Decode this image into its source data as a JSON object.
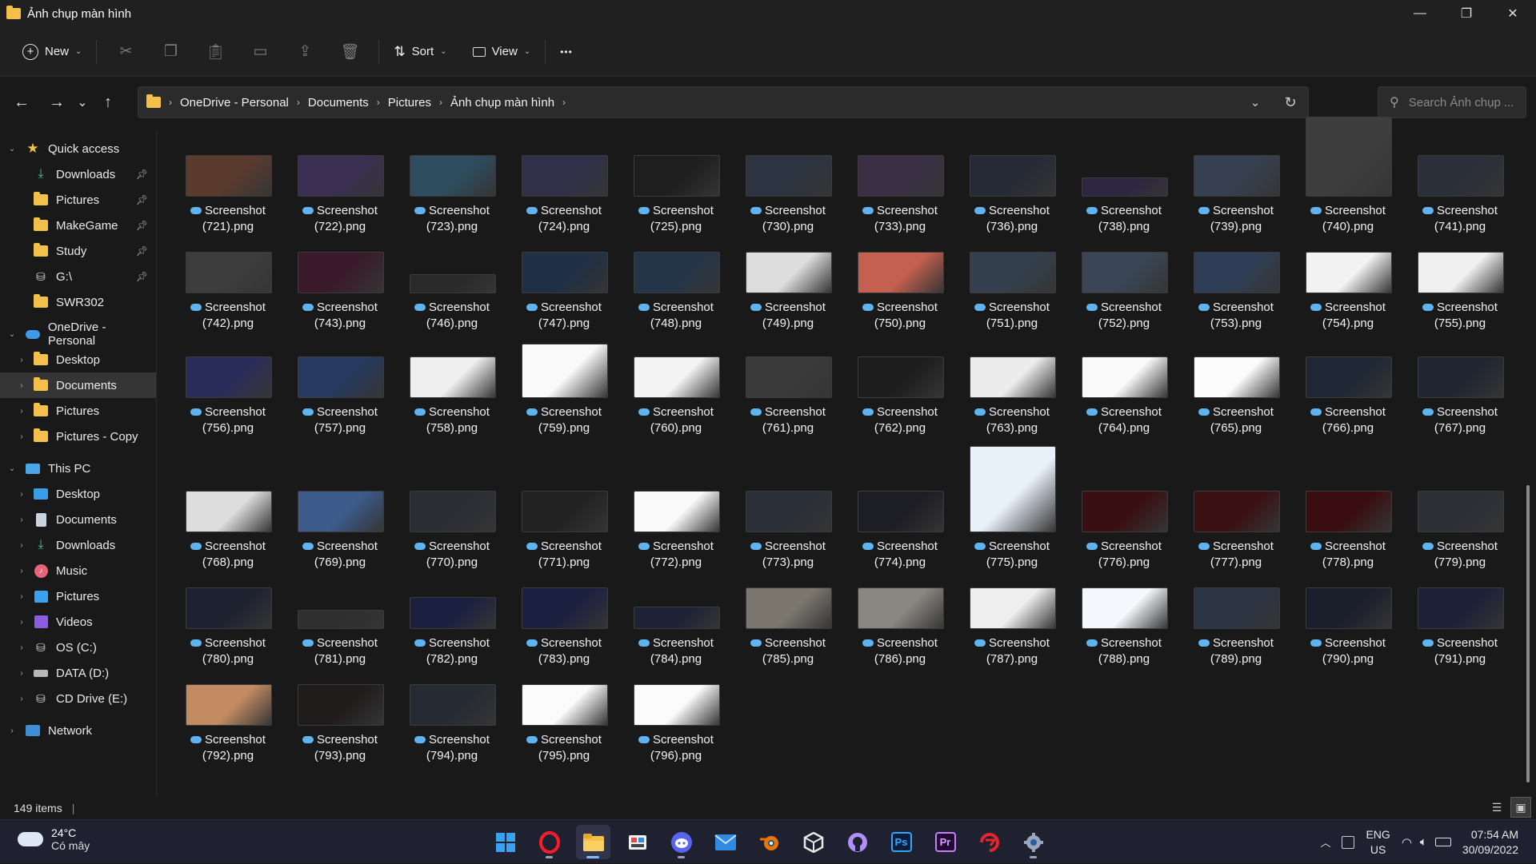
{
  "window": {
    "title": "Ảnh chụp màn hình",
    "minimize": "—",
    "restore": "❐",
    "close": "✕"
  },
  "toolbar": {
    "new_label": "New",
    "sort_label": "Sort",
    "view_label": "View",
    "more_label": "•••",
    "icons": [
      "cut-icon",
      "copy-icon",
      "paste-icon",
      "rename-icon",
      "share-icon",
      "delete-icon"
    ]
  },
  "nav": {
    "back": "←",
    "forward": "→",
    "recent": "⌄",
    "up": "↑"
  },
  "breadcrumb": [
    "OneDrive - Personal",
    "Documents",
    "Pictures",
    "Ảnh chụp màn hình"
  ],
  "search": {
    "placeholder": "Search Ảnh chụp ..."
  },
  "sidebar": {
    "quick_access": "Quick access",
    "quick_items": [
      {
        "label": "Downloads"
      },
      {
        "label": "Pictures"
      },
      {
        "label": "MakeGame"
      },
      {
        "label": "Study"
      },
      {
        "label": "G:\\"
      },
      {
        "label": "SWR302"
      }
    ],
    "onedrive": "OneDrive - Personal",
    "onedrive_items": [
      {
        "label": "Desktop"
      },
      {
        "label": "Documents"
      },
      {
        "label": "Pictures"
      },
      {
        "label": "Pictures - Copy"
      }
    ],
    "this_pc": "This PC",
    "pc_items": [
      {
        "label": "Desktop"
      },
      {
        "label": "Documents"
      },
      {
        "label": "Downloads"
      },
      {
        "label": "Music"
      },
      {
        "label": "Pictures"
      },
      {
        "label": "Videos"
      },
      {
        "label": "OS (C:)"
      },
      {
        "label": "DATA (D:)"
      },
      {
        "label": "CD Drive (E:)"
      }
    ],
    "network": "Network"
  },
  "files": {
    "name_prefix": "Screenshot",
    "rows": [
      [
        "(721).png",
        "(722).png",
        "(723).png",
        "(724).png",
        "(725).png",
        "(730).png",
        "(733).png",
        "(736).png",
        "(738).png",
        "(739).png",
        "(740).png",
        "(741).png"
      ],
      [
        "(742).png",
        "(743).png",
        "(746).png",
        "(747).png",
        "(748).png",
        "(749).png",
        "(750).png",
        "(751).png",
        "(752).png",
        "(753).png",
        "(754).png",
        "(755).png"
      ],
      [
        "(756).png",
        "(757).png",
        "(758).png",
        "(759).png",
        "(760).png",
        "(761).png",
        "(762).png",
        "(763).png",
        "(764).png",
        "(765).png",
        "(766).png",
        "(767).png"
      ],
      [
        "(768).png",
        "(769).png",
        "(770).png",
        "(771).png",
        "(772).png",
        "(773).png",
        "(774).png",
        "(775).png",
        "(776).png",
        "(777).png",
        "(778).png",
        "(779).png"
      ],
      [
        "(780).png",
        "(781).png",
        "(782).png",
        "(783).png",
        "(784).png",
        "(785).png",
        "(786).png",
        "(787).png",
        "(788).png",
        "(789).png",
        "(790).png",
        "(791).png"
      ],
      [
        "(792).png",
        "(793).png",
        "(794).png",
        "(795).png",
        "(796).png"
      ]
    ]
  },
  "status": {
    "count": "149 items"
  },
  "taskbar": {
    "temp": "24°C",
    "weather": "Có mây",
    "lang1": "ENG",
    "lang2": "US",
    "time": "07:54 AM",
    "date": "30/09/2022",
    "apps": [
      "windows-start-icon",
      "opera-icon",
      "file-explorer-icon",
      "paint-tool-icon",
      "discord-icon",
      "mail-icon",
      "blender-icon",
      "unity-icon",
      "github-icon",
      "photoshop-icon",
      "premiere-icon",
      "garena-icon",
      "settings-icon"
    ],
    "app_text": {
      "ps": "Ps",
      "pr": "Pr"
    }
  }
}
